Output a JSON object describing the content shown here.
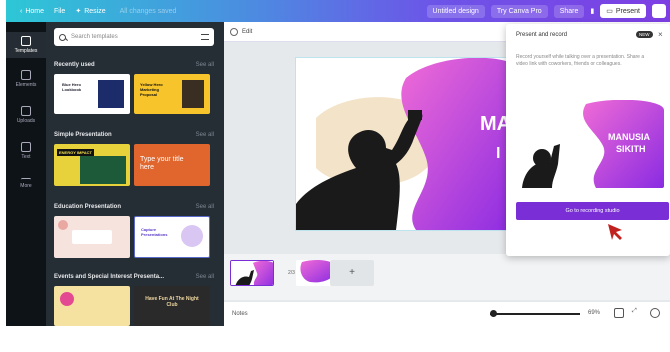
{
  "topbar": {
    "home": "Home",
    "file": "File",
    "resize": "Resize",
    "design_title": "Untitled design",
    "undo_hint": "Undo",
    "all_changes": "All changes saved",
    "share": "Share",
    "present": "Present",
    "try_pro": "Try Canva Pro"
  },
  "rail": {
    "items": [
      "Templates",
      "Elements",
      "Uploads",
      "Text",
      "More"
    ]
  },
  "panel": {
    "search_placeholder": "Search templates",
    "sections": [
      {
        "title": "Recently used",
        "see_all": "See all"
      },
      {
        "title": "Simple Presentation",
        "see_all": "See all"
      },
      {
        "title": "Education Presentation",
        "see_all": "See all"
      },
      {
        "title": "Events and Special Interest Presenta...",
        "see_all": "See all"
      }
    ],
    "thumb_texts": {
      "t1": "Blue Hero Lookbook",
      "t2": "Yellow Hero Marketing Proposal",
      "t3": "ENERGY IMPACT",
      "t4": "Type your title here",
      "t5": "Capture Presentations",
      "t6": "Have Fun At The Night Club"
    }
  },
  "editor": {
    "edit_label": "Edit",
    "slide_text": "MA",
    "slide_text2": "I",
    "notes": "Notes",
    "zoom": "69%",
    "page_label": "2/3"
  },
  "popup": {
    "title": "Present and record",
    "badge": "NEW",
    "description": "Record yourself while talking over a presentation. Share a video link with coworkers, friends or colleagues.",
    "preview_title": "MANUSIA",
    "preview_title2": "SIKITH",
    "button": "Go to recording studio"
  },
  "colors": {
    "accent": "#7a2fd6",
    "panel_bg": "#252d35",
    "rail_bg": "#0e1318"
  }
}
